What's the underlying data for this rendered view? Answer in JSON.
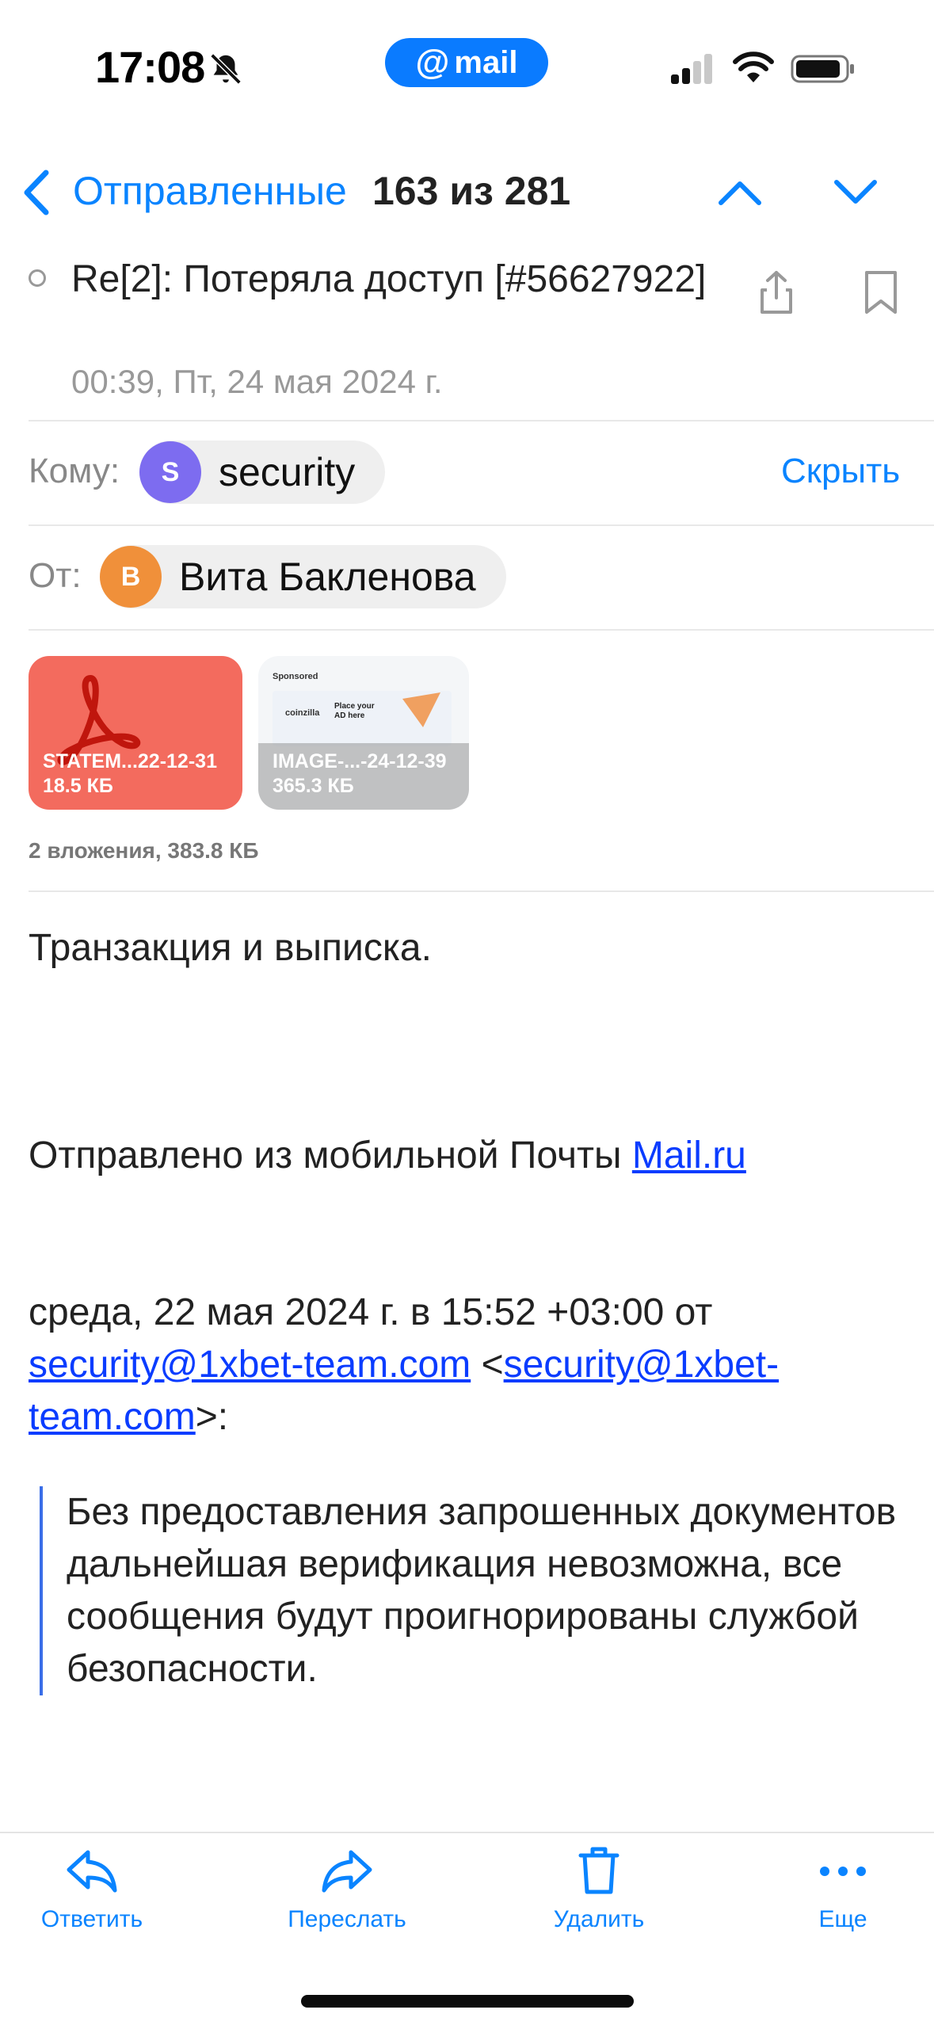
{
  "status_bar": {
    "time": "17:08",
    "app_pill": "mail",
    "app_pill_at": "@"
  },
  "nav": {
    "back_label": "Отправленные",
    "counter": "163 из 281"
  },
  "message": {
    "subject": "Re[2]: Потеряла доступ [#56627922]",
    "date": "00:39, Пт, 24 мая 2024 г.",
    "to_label": "Кому:",
    "to_name": "security",
    "to_initial": "S",
    "hide_label": "Скрыть",
    "from_label": "От:",
    "from_name": "Вита Бакленова",
    "from_initial": "В"
  },
  "attachments": {
    "items": [
      {
        "name": "STATEM...22-12-31",
        "size": "18.5 КБ"
      },
      {
        "name": "IMAGE-...-24-12-39",
        "size": "365.3 КБ"
      }
    ],
    "summary": "2 вложения, 383.8 КБ",
    "thumb_sponsored": "Sponsored",
    "thumb_brand": "coinzilla",
    "thumb_ad": "Place your AD here"
  },
  "body": {
    "line1": "Транзакция и выписка.",
    "sent_from": "Отправлено из мобильной Почты ",
    "sent_from_link": "Mail.ru",
    "quote_header_prefix": "среда, 22 мая 2024 г. в 15:52 +03:00 от ",
    "quote_email1": "security@1xbet-team.com",
    "quote_lt": " <",
    "quote_email2_a": "security@1xbet-",
    "quote_email2_b": "team.com",
    "quote_gt": ">:",
    "quote_text": "Без предоставления запрошенных документов дальнейшая верификация невозможна, все сообщения будут проигнорированы службой безопасности."
  },
  "toolbar": {
    "reply": "Ответить",
    "forward": "Переслать",
    "delete": "Удалить",
    "more": "Еще"
  },
  "colors": {
    "accent": "#0a84ff",
    "pdf": "#f36b5e",
    "avatar_s": "#7d6cf0",
    "avatar_v": "#f0903a"
  }
}
